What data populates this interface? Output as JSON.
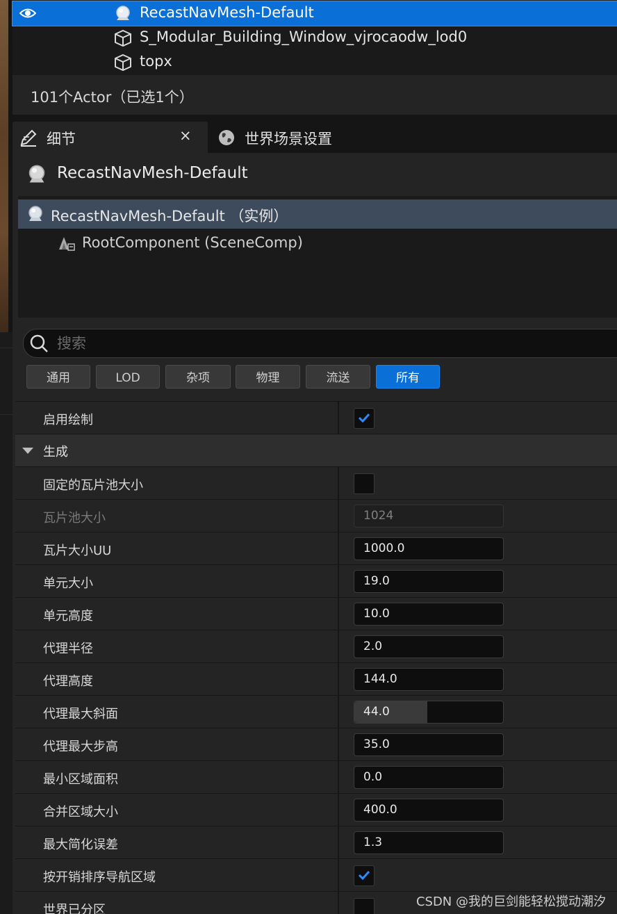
{
  "outliner": {
    "rows": [
      {
        "label": "RecastNavMesh-Default",
        "selected": true,
        "icon": "navmesh-icon",
        "visible": true
      },
      {
        "label": "S_Modular_Building_Window_vjrocaodw_lod0",
        "selected": false,
        "icon": "static-mesh-icon"
      },
      {
        "label": "topx",
        "selected": false,
        "icon": "static-mesh-icon"
      }
    ],
    "status": "101个Actor（已选1个）"
  },
  "tabs": [
    {
      "label": "细节",
      "icon": "details-pencil-icon",
      "active": true,
      "close": "×"
    },
    {
      "label": "世界场景设置",
      "icon": "world-globe-icon",
      "active": false
    }
  ],
  "details": {
    "title": "RecastNavMesh-Default",
    "components": [
      {
        "label": "RecastNavMesh-Default （实例）",
        "selected": true
      },
      {
        "label": "RootComponent (SceneComp)",
        "selected": false
      }
    ],
    "search": {
      "placeholder": "搜索",
      "value": ""
    },
    "filters": [
      "通用",
      "LOD",
      "杂项",
      "物理",
      "流送",
      "所有"
    ],
    "active_filter": "所有",
    "rows": [
      {
        "kind": "prop",
        "label": "启用绘制",
        "type": "checkbox",
        "checked": true
      },
      {
        "kind": "category",
        "label": "生成"
      },
      {
        "kind": "prop",
        "label": "固定的瓦片池大小",
        "type": "checkbox",
        "checked": false
      },
      {
        "kind": "prop",
        "label": "瓦片池大小",
        "type": "number",
        "value": "1024",
        "disabled": true
      },
      {
        "kind": "prop",
        "label": "瓦片大小UU",
        "type": "number",
        "value": "1000.0"
      },
      {
        "kind": "prop",
        "label": "单元大小",
        "type": "number",
        "value": "19.0"
      },
      {
        "kind": "prop",
        "label": "单元高度",
        "type": "number",
        "value": "10.0"
      },
      {
        "kind": "prop",
        "label": "代理半径",
        "type": "number",
        "value": "2.0"
      },
      {
        "kind": "prop",
        "label": "代理高度",
        "type": "number",
        "value": "144.0"
      },
      {
        "kind": "prop",
        "label": "代理最大斜面",
        "type": "slider",
        "value": "44.0",
        "fraction": 0.49
      },
      {
        "kind": "prop",
        "label": "代理最大步高",
        "type": "number",
        "value": "35.0"
      },
      {
        "kind": "prop",
        "label": "最小区域面积",
        "type": "number",
        "value": "0.0"
      },
      {
        "kind": "prop",
        "label": "合并区域大小",
        "type": "number",
        "value": "400.0"
      },
      {
        "kind": "prop",
        "label": "最大简化误差",
        "type": "number",
        "value": "1.3"
      },
      {
        "kind": "prop",
        "label": "按开销排序导航区域",
        "type": "checkbox",
        "checked": true
      },
      {
        "kind": "prop",
        "label": "世界已分区",
        "type": "checkbox",
        "checked": false
      }
    ]
  },
  "watermark": "CSDN @我的巨剑能轻松搅动潮汐",
  "colors": {
    "accent": "#0a6fd6",
    "panel": "#242424",
    "field": "#0e0e0e",
    "check": "#2a8cff"
  }
}
